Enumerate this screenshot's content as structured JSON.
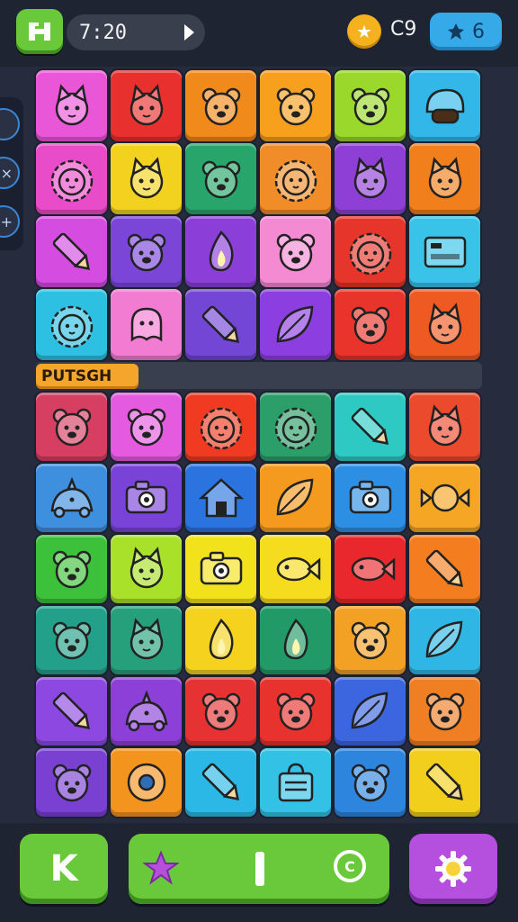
{
  "header": {
    "home_icon": "home-icon",
    "timer": "7:20",
    "coin_icon": "star-coin-icon",
    "coin_count": "C9",
    "gem_icon": "gem-icon",
    "gem_count": "6"
  },
  "side_panel": {
    "buttons": [
      {
        "icon": "circle-icon",
        "label": ""
      },
      {
        "icon": "close-icon",
        "label": "×"
      },
      {
        "icon": "plus-icon",
        "label": "+"
      }
    ]
  },
  "board_top": {
    "tiles": [
      {
        "color": "#e957d8",
        "icon": "cat"
      },
      {
        "color": "#e8302e",
        "icon": "cat"
      },
      {
        "color": "#f08a1b",
        "icon": "bear"
      },
      {
        "color": "#f6a01e",
        "icon": "bear"
      },
      {
        "color": "#9ad82c",
        "icon": "bear"
      },
      {
        "color": "#33b7e8",
        "icon": "helmet"
      },
      {
        "color": "#e94cc8",
        "icon": "lion"
      },
      {
        "color": "#f2d21e",
        "icon": "cat"
      },
      {
        "color": "#28a56a",
        "icon": "bear"
      },
      {
        "color": "#f08d28",
        "icon": "lion"
      },
      {
        "color": "#8e3fd6",
        "icon": "cat"
      },
      {
        "color": "#f07f1c",
        "icon": "cat"
      },
      {
        "color": "#d44ce0",
        "icon": "pencil"
      },
      {
        "color": "#7b46d8",
        "icon": "bear"
      },
      {
        "color": "#8b3fd8",
        "icon": "flame"
      },
      {
        "color": "#f38ad2",
        "icon": "bear"
      },
      {
        "color": "#e6352a",
        "icon": "lion"
      },
      {
        "color": "#39c3e8",
        "icon": "box"
      },
      {
        "color": "#2ec0e2",
        "icon": "lion"
      },
      {
        "color": "#f27cd2",
        "icon": "ghost"
      },
      {
        "color": "#7346d6",
        "icon": "pencil"
      },
      {
        "color": "#8d3ee0",
        "icon": "leaf"
      },
      {
        "color": "#e8342b",
        "icon": "bear"
      },
      {
        "color": "#ef5a22",
        "icon": "cat"
      }
    ]
  },
  "divider_label": "PUTSGH",
  "board_bottom": {
    "tiles": [
      {
        "color": "#d63e62",
        "icon": "bear"
      },
      {
        "color": "#e45be0",
        "icon": "bear"
      },
      {
        "color": "#f03b22",
        "icon": "lion"
      },
      {
        "color": "#2c9e6a",
        "icon": "lion"
      },
      {
        "color": "#2fc9c4",
        "icon": "pencil"
      },
      {
        "color": "#ec4a2c",
        "icon": "cat"
      },
      {
        "color": "#3f8fdf",
        "icon": "dino"
      },
      {
        "color": "#7a43d8",
        "icon": "camera"
      },
      {
        "color": "#2b74e0",
        "icon": "house"
      },
      {
        "color": "#f39a1f",
        "icon": "leaf"
      },
      {
        "color": "#2d8fe4",
        "icon": "camera"
      },
      {
        "color": "#f5a625",
        "icon": "candy"
      },
      {
        "color": "#3ec13a",
        "icon": "bear"
      },
      {
        "color": "#a8e02a",
        "icon": "cat"
      },
      {
        "color": "#f2e21c",
        "icon": "camera"
      },
      {
        "color": "#f6dc1f",
        "icon": "fish"
      },
      {
        "color": "#e8282c",
        "icon": "fish"
      },
      {
        "color": "#f37d1f",
        "icon": "pencil"
      },
      {
        "color": "#23a089",
        "icon": "bear"
      },
      {
        "color": "#26a07a",
        "icon": "cat"
      },
      {
        "color": "#f4d21e",
        "icon": "flame"
      },
      {
        "color": "#229a68",
        "icon": "flame"
      },
      {
        "color": "#f2a124",
        "icon": "bear"
      },
      {
        "color": "#2fb6e4",
        "icon": "leaf"
      },
      {
        "color": "#8d48e2",
        "icon": "pencil"
      },
      {
        "color": "#8c40d8",
        "icon": "dino"
      },
      {
        "color": "#e63232",
        "icon": "bear"
      },
      {
        "color": "#e8322e",
        "icon": "bear"
      },
      {
        "color": "#3b66e0",
        "icon": "leaf"
      },
      {
        "color": "#f07e22",
        "icon": "bear"
      },
      {
        "color": "#7940d2",
        "icon": "bear"
      },
      {
        "color": "#f2941e",
        "icon": "donut"
      },
      {
        "color": "#2cb8e6",
        "icon": "pencil"
      },
      {
        "color": "#33c2e6",
        "icon": "bag"
      },
      {
        "color": "#2d85de",
        "icon": "bear"
      },
      {
        "color": "#f2cf1c",
        "icon": "pencil"
      }
    ]
  },
  "footer": {
    "back_label": "K",
    "star_icon": "star-icon",
    "separator_label": "",
    "ring_label": "C",
    "settings_icon": "gear-icon"
  },
  "colors": {
    "background": "#262c3d",
    "green_button": "#6ac93a",
    "purple_button": "#b450dd",
    "label_orange": "#f3a62b"
  }
}
